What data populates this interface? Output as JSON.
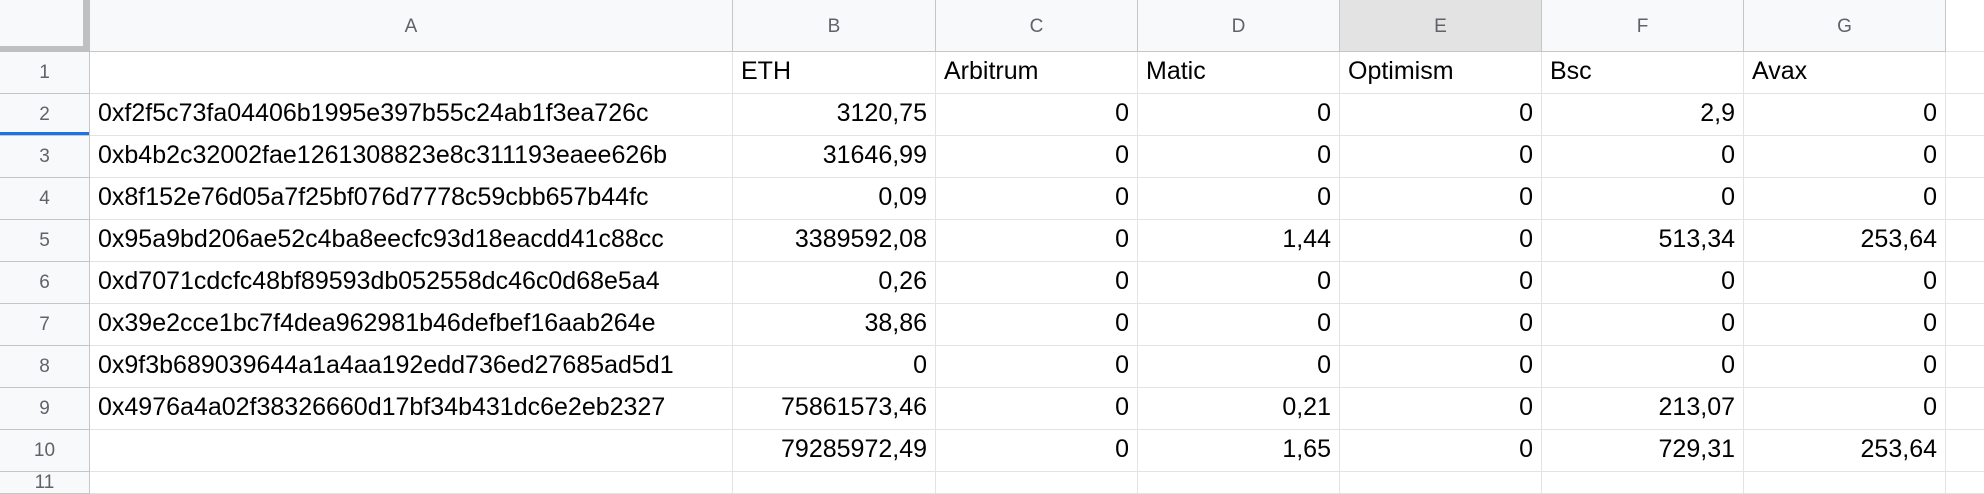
{
  "columns": [
    "A",
    "B",
    "C",
    "D",
    "E",
    "F",
    "G"
  ],
  "row_numbers": [
    "1",
    "2",
    "3",
    "4",
    "5",
    "6",
    "7",
    "8",
    "9",
    "10",
    "11"
  ],
  "header_row": [
    "",
    "ETH",
    "Arbitrum",
    "Matic",
    "Optimism",
    "Bsc",
    "Avax"
  ],
  "rows": [
    [
      "0xf2f5c73fa04406b1995e397b55c24ab1f3ea726c",
      "3120,75",
      "0",
      "0",
      "0",
      "2,9",
      "0"
    ],
    [
      "0xb4b2c32002fae1261308823e8c311193eaee626b",
      "31646,99",
      "0",
      "0",
      "0",
      "0",
      "0"
    ],
    [
      "0x8f152e76d05a7f25bf076d7778c59cbb657b44fc",
      "0,09",
      "0",
      "0",
      "0",
      "0",
      "0"
    ],
    [
      "0x95a9bd206ae52c4ba8eecfc93d18eacdd41c88cc",
      "3389592,08",
      "0",
      "1,44",
      "0",
      "513,34",
      "253,64"
    ],
    [
      "0xd7071cdcfc48bf89593db052558dc46c0d68e5a4",
      "0,26",
      "0",
      "0",
      "0",
      "0",
      "0"
    ],
    [
      "0x39e2cce1bc7f4dea962981b46defbef16aab264e",
      "38,86",
      "0",
      "0",
      "0",
      "0",
      "0"
    ],
    [
      "0x9f3b689039644a1a4aa192edd736ed27685ad5d1",
      "0",
      "0",
      "0",
      "0",
      "0",
      "0"
    ],
    [
      "0x4976a4a02f38326660d17bf34b431dc6e2eb2327",
      "75861573,46",
      "0",
      "0,21",
      "0",
      "213,07",
      "0"
    ],
    [
      "",
      "79285972,49",
      "0",
      "1,65",
      "0",
      "729,31",
      "253,64"
    ]
  ]
}
